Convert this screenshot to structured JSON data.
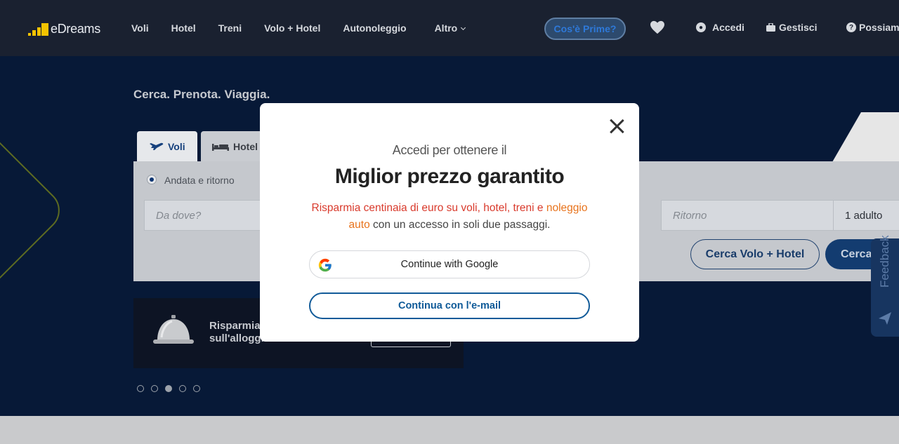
{
  "header": {
    "logo_text": "eDreams",
    "nav": [
      {
        "label": "Voli"
      },
      {
        "label": "Hotel"
      },
      {
        "label": "Treni"
      },
      {
        "label": "Volo + Hotel"
      },
      {
        "label": "Autonoleggio"
      },
      {
        "label": "Altro"
      }
    ],
    "prime_label": "Cos'è Prime?",
    "wishlist_icon": "heart-icon",
    "login_label": "Accedi",
    "manage_label": "Gestisci",
    "help_label": "Possiam"
  },
  "hero": {
    "tagline": "Cerca. Prenota. Viaggia.",
    "tabs": [
      {
        "label": "Voli",
        "icon": "plane-icon"
      },
      {
        "label": "Hotel",
        "icon": "bed-icon"
      }
    ],
    "trip_type_label": "Andata e ritorno",
    "origin_placeholder": "Da dove?",
    "return_placeholder": "Ritorno",
    "passengers": "1 adulto",
    "flight_hotel_button": "Cerca Volo + Hotel",
    "search_button": "Cerca",
    "promo_text_line1": "Risparmia",
    "promo_text_line2": "sull'alloggio",
    "carousel_active_index": 2,
    "carousel_count": 5,
    "feedback_label": "Feedback"
  },
  "modal": {
    "subtitle": "Accedi per ottenere il",
    "title": "Miglior prezzo garantito",
    "desc_red": "Risparmia centinaia di euro su voli, hotel, treni e",
    "desc_orange": "noleggio auto",
    "desc_rest": " con un accesso in soli due passaggi.",
    "google_button": "Continue with Google",
    "email_button": "Continua con l'e-mail"
  },
  "colors": {
    "overlay_bg": "#061a3a",
    "brand_yellow": "#f4c300",
    "primary_blue": "#0f5a98",
    "accent_red": "#d93a2c",
    "accent_orange": "#e8731c"
  }
}
